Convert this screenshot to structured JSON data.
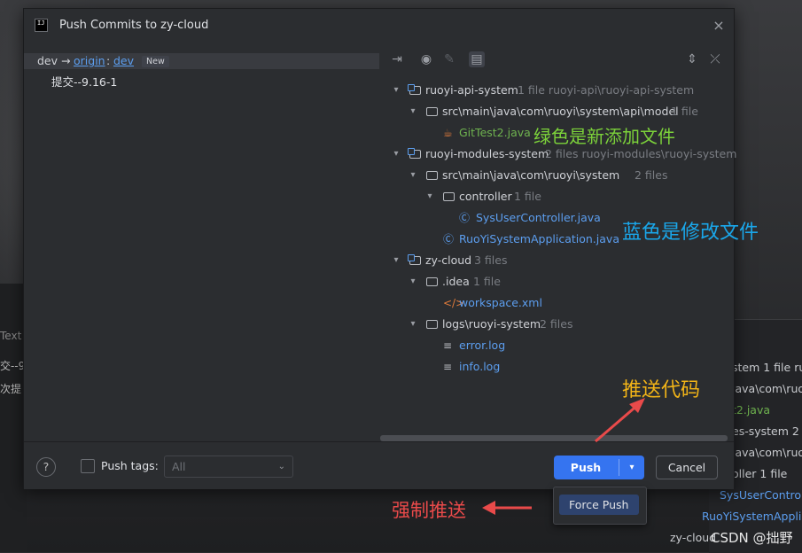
{
  "background": {
    "left_rows": [
      "Text",
      "交--9",
      "次提"
    ],
    "right_rows": [
      {
        "text": "stem 1 file ru",
        "style": ""
      },
      {
        "text": "java\\com\\ruo",
        "style": ""
      },
      {
        "text": "t2.java",
        "style": "green"
      },
      {
        "text": "es-system 2 fi",
        "style": ""
      },
      {
        "text": "java\\com\\ruo",
        "style": ""
      },
      {
        "text": "oller 1 file",
        "style": ""
      },
      {
        "text": "SysUserControll",
        "style": "blue"
      },
      {
        "text": "RuoYiSystemApplica",
        "style": "blue"
      },
      {
        "text": "zy-cloud",
        "style": ""
      }
    ]
  },
  "dialog": {
    "title": "Push Commits to zy-cloud",
    "app_icon_text": "IJ",
    "close_icon": "×"
  },
  "left": {
    "local_branch": "dev",
    "arrow": "→",
    "remote": "origin",
    "separator": ":",
    "remote_branch": "dev",
    "badge": "New",
    "commit": "提交--9.16-1"
  },
  "tree": [
    {
      "label": "ruoyi-api-system",
      "meta": "1 file  ruoyi-api\\ruoyi-api-system"
    },
    {
      "label": "src\\main\\java\\com\\ruoyi\\system\\api\\model",
      "meta": "1 file"
    },
    {
      "label": "GitTest2.java",
      "meta": ""
    },
    {
      "label": "ruoyi-modules-system",
      "meta": "2 files  ruoyi-modules\\ruoyi-system"
    },
    {
      "label": "src\\main\\java\\com\\ruoyi\\system",
      "meta": "2 files"
    },
    {
      "label": "controller",
      "meta": "1 file"
    },
    {
      "label": "SysUserController.java",
      "meta": ""
    },
    {
      "label": "RuoYiSystemApplication.java",
      "meta": ""
    },
    {
      "label": "zy-cloud",
      "meta": "3 files"
    },
    {
      "label": ".idea",
      "meta": "1 file"
    },
    {
      "label": "workspace.xml",
      "meta": ""
    },
    {
      "label": "logs\\ruoyi-system",
      "meta": "2 files"
    },
    {
      "label": "error.log",
      "meta": ""
    },
    {
      "label": "info.log",
      "meta": ""
    }
  ],
  "footer": {
    "help": "?",
    "push_tags_label": "Push tags:",
    "tags_select_value": "All",
    "push_label": "Push",
    "cancel_label": "Cancel",
    "force_push": "Force Push"
  },
  "annotations": {
    "green": "绿色是新添加文件",
    "blue": "蓝色是修改文件",
    "orange": "推送代码",
    "red": "强制推送"
  },
  "watermark": "CSDN @拙野",
  "colors": {
    "accent": "#3574f0",
    "added": "#6fb34f",
    "modified": "#5c9eef"
  }
}
